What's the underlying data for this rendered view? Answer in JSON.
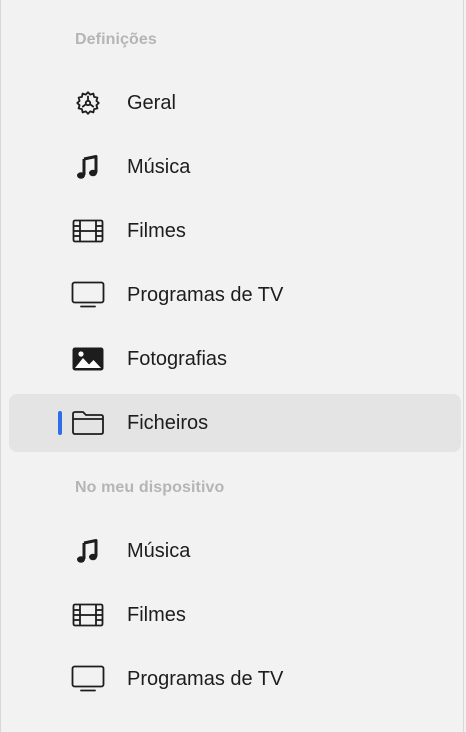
{
  "sections": [
    {
      "header": "Definições",
      "items": [
        {
          "label": "Geral",
          "icon": "gear-icon",
          "selected": false
        },
        {
          "label": "Música",
          "icon": "music-note-icon",
          "selected": false
        },
        {
          "label": "Filmes",
          "icon": "film-icon",
          "selected": false
        },
        {
          "label": "Programas de TV",
          "icon": "tv-icon",
          "selected": false
        },
        {
          "label": "Fotografias",
          "icon": "photo-icon",
          "selected": false
        },
        {
          "label": "Ficheiros",
          "icon": "folder-icon",
          "selected": true
        }
      ]
    },
    {
      "header": "No meu dispositivo",
      "items": [
        {
          "label": "Música",
          "icon": "music-note-icon",
          "selected": false
        },
        {
          "label": "Filmes",
          "icon": "film-icon",
          "selected": false
        },
        {
          "label": "Programas de TV",
          "icon": "tv-icon",
          "selected": false
        }
      ]
    }
  ],
  "colors": {
    "background": "#f2f2f2",
    "selected_background": "#e4e4e4",
    "selection_indicator": "#2f6ee8",
    "header_text": "#b5b5b5",
    "item_text": "#1d1d1d"
  }
}
